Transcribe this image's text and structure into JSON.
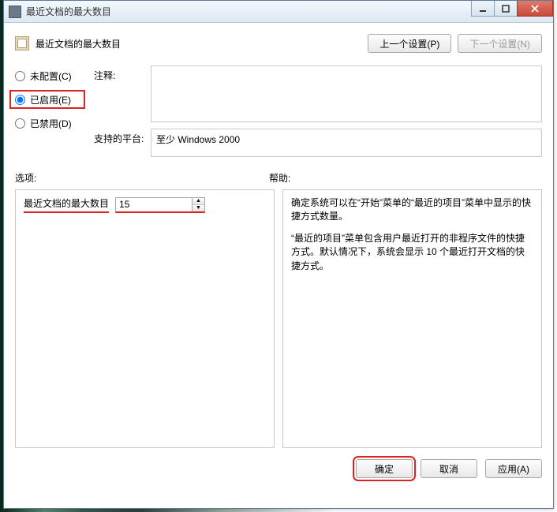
{
  "window": {
    "title": "最近文档的最大数目"
  },
  "header": {
    "title": "最近文档的最大数目",
    "prev_button": "上一个设置(P)",
    "next_button": "下一个设置(N)"
  },
  "radios": {
    "not_configured": "未配置(C)",
    "enabled": "已启用(E)",
    "disabled": "已禁用(D)",
    "selected": "enabled"
  },
  "labels": {
    "comment": "注释:",
    "platform": "支持的平台:",
    "options": "选项:",
    "help": "帮助:"
  },
  "platform_text": "至少 Windows 2000",
  "option": {
    "label": "最近文档的最大数目",
    "value": "15"
  },
  "help": {
    "p1": "确定系统可以在“开始”菜单的“最近的项目”菜单中显示的快捷方式数量。",
    "p2": "“最近的项目”菜单包含用户最近打开的非程序文件的快捷方式。默认情况下，系统会显示 10 个最近打开文档的快捷方式。"
  },
  "footer": {
    "ok": "确定",
    "cancel": "取消",
    "apply": "应用(A)"
  }
}
